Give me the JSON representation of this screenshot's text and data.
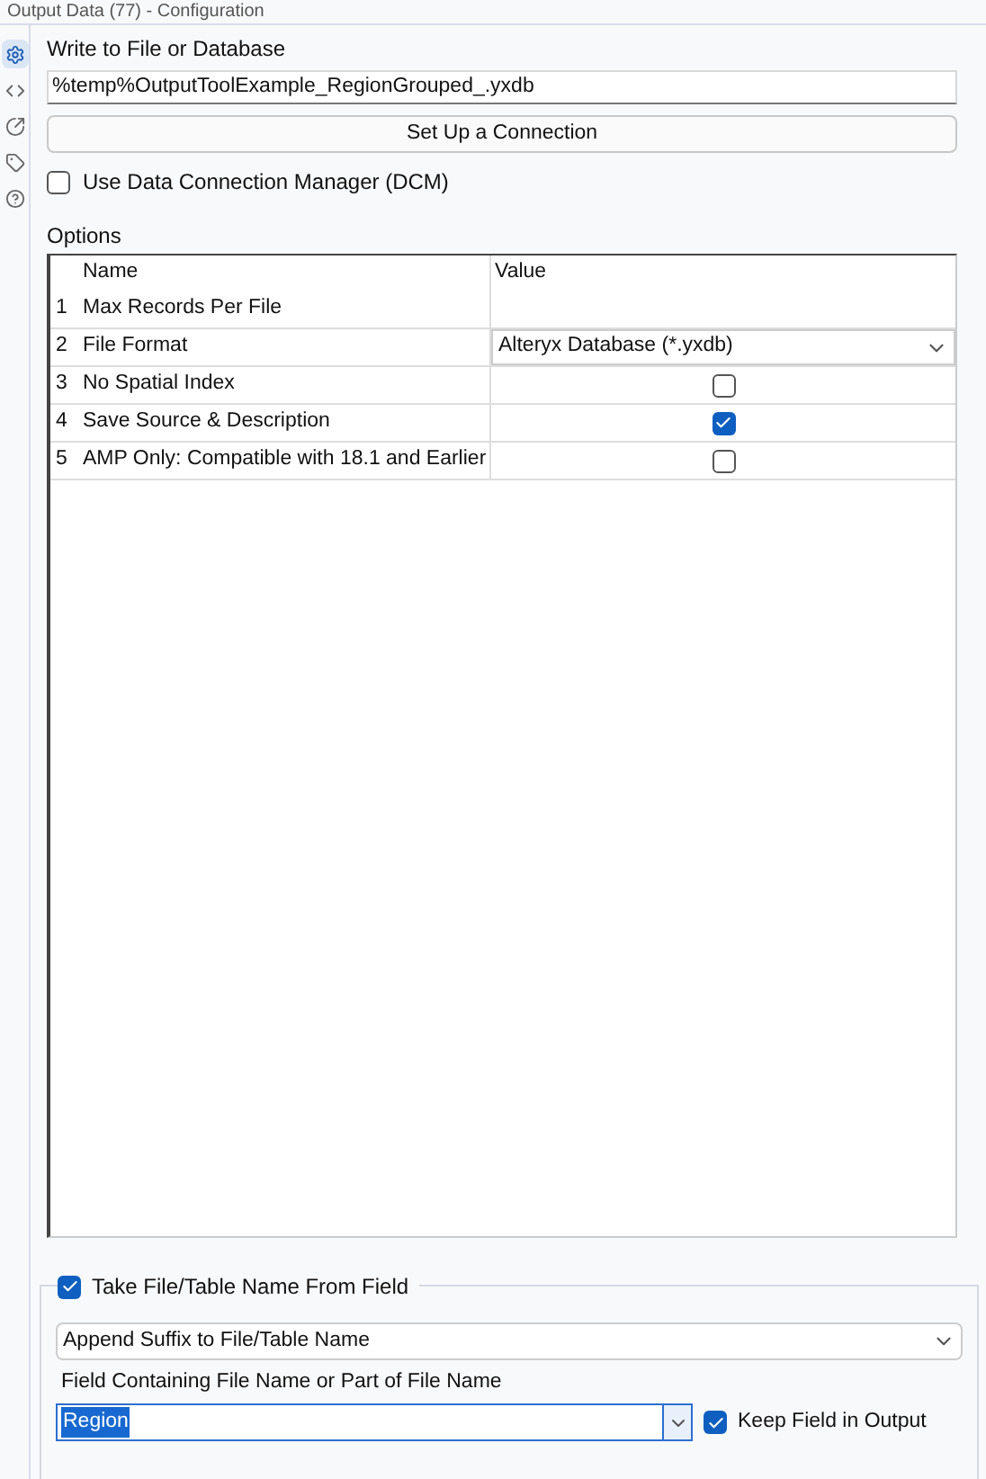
{
  "header": {
    "title": "Output Data (77) - Configuration"
  },
  "sidebar": {
    "items": [
      {
        "selected": true
      },
      {
        "selected": false
      },
      {
        "selected": false
      },
      {
        "selected": false
      },
      {
        "selected": false
      }
    ]
  },
  "write_to": {
    "label": "Write to File or Database",
    "value": "%temp%OutputToolExample_RegionGrouped_.yxdb",
    "button": "Set Up a Connection"
  },
  "dcm": {
    "label": "Use Data Connection Manager (DCM)",
    "checked": false
  },
  "options": {
    "label": "Options",
    "columns": [
      "Name",
      "Value"
    ],
    "rows": [
      {
        "index": "1",
        "name": "Max Records Per File",
        "kind": "text"
      },
      {
        "index": "2",
        "name": "File Format",
        "kind": "dropdown",
        "value": "Alteryx Database (*.yxdb)"
      },
      {
        "index": "3",
        "name": "No Spatial Index",
        "kind": "checkbox",
        "checked": false
      },
      {
        "index": "4",
        "name": "Save Source & Description",
        "kind": "checkbox",
        "checked": true
      },
      {
        "index": "5",
        "name": "AMP Only: Compatible with 18.1 and Earlier",
        "kind": "checkbox",
        "checked": false
      }
    ]
  },
  "take_name": {
    "label": "Take File/Table Name From Field",
    "checked": true,
    "mode": "Append Suffix to File/Table Name",
    "field_label": "Field Containing File Name or Part of File Name",
    "field": "Region",
    "keep_label": "Keep Field in Output",
    "keep_checked": true
  }
}
